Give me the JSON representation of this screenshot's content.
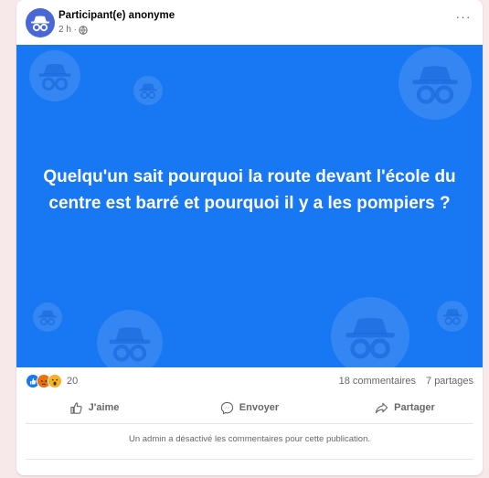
{
  "post": {
    "author": "Participant(e) anonyme",
    "time": "2 h ·",
    "more_label": "···",
    "banner_text": "Quelqu'un sait pourquoi la route devant l'école du centre est barré et pourquoi il y a les pompiers ?",
    "banner_color": "#1877f2"
  },
  "stats": {
    "reaction_count": "20",
    "comments": "18 commentaires",
    "shares": "7 partages"
  },
  "actions": {
    "like": "J'aime",
    "send": "Envoyer",
    "share": "Partager"
  },
  "notice": "Un admin a désactivé les commentaires pour cette publication.",
  "icons": [
    "anonymous-avatar-icon",
    "globe-icon",
    "more-icon",
    "like-reaction-icon",
    "angry-reaction-icon",
    "wow-reaction-icon",
    "thumbs-up-icon",
    "messenger-icon",
    "share-arrow-icon"
  ]
}
